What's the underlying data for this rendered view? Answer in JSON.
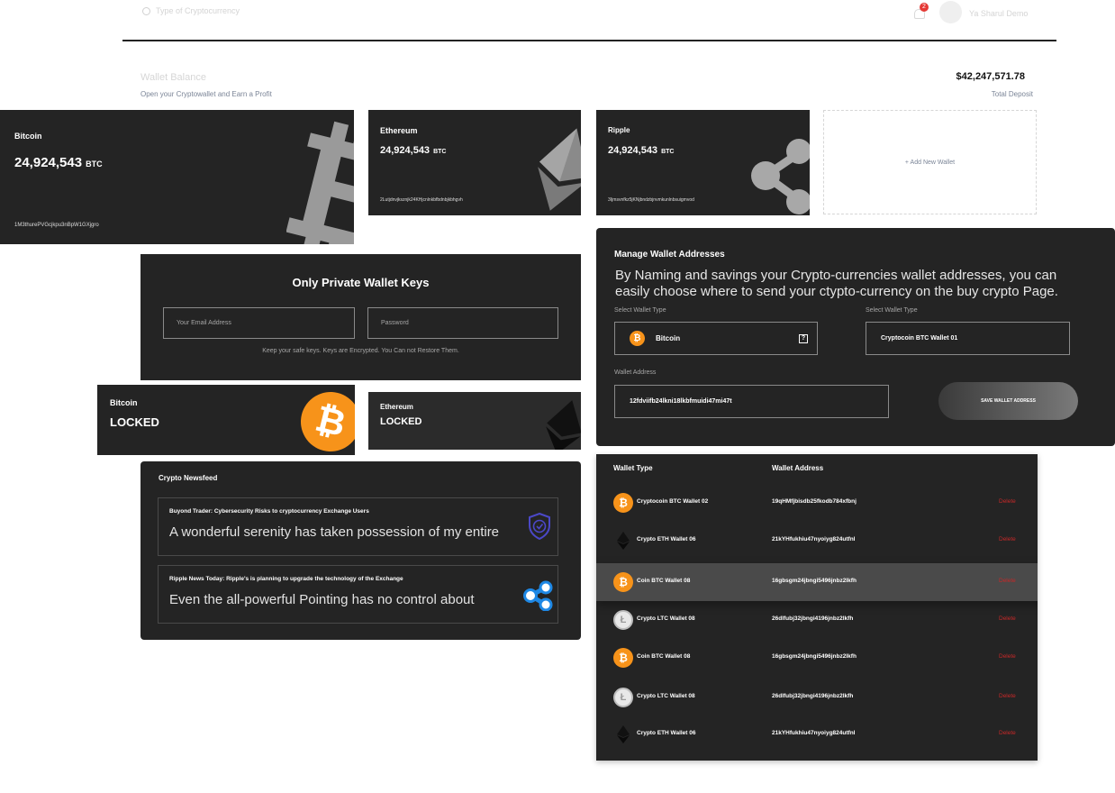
{
  "header": {
    "search_placeholder": "Type of Cryptocurrency",
    "notification_count": "2",
    "user_name": "Ya Sharul Demo"
  },
  "wallet_balance": {
    "title": "Wallet Balance",
    "subtitle": "Open your Cryptowallet and Earn a Profit",
    "total_amount": "$42,247,571.78",
    "total_label": "Total Deposit"
  },
  "wallets": [
    {
      "name": "Bitcoin",
      "amount": "24,924,543",
      "unit": "BTC",
      "address": "1M3thurePVGcjkpu3nBpW1GXjgro"
    },
    {
      "name": "Ethereum",
      "amount": "24,924,543",
      "unit": "BTC",
      "address": "2Lutjdnvjksznjk24KHjcnlnkbfbdnbjkbhgvh"
    },
    {
      "name": "Ripple",
      "amount": "24,924,543",
      "unit": "BTC",
      "address": "3Ijmsvnfkz5jKNjbndzbjnvmkunlnbsuigmvod"
    }
  ],
  "add_wallet_label": "+ Add New Wallet",
  "private_keys": {
    "title": "Only Private Wallet Keys",
    "email_placeholder": "Your Email Address",
    "password_placeholder": "Password",
    "note": "Keep your safe keys. Keys are Encrypted. You Can not Restore Them."
  },
  "locked": [
    {
      "name": "Bitcoin",
      "status": "LOCKED"
    },
    {
      "name": "Ethereum",
      "status": "LOCKED"
    }
  ],
  "newsfeed": {
    "title": "Crypto Newsfeed",
    "items": [
      {
        "headline": "Buyond Trader: Cybersecurity Risks to cryptocurrency Exchange Users",
        "body": "A wonderful serenity has taken possession of my entire"
      },
      {
        "headline": "Ripple News Today: Ripple's is planning to upgrade the technology of the Exchange",
        "body": "Even the all-powerful Pointing has no control about"
      }
    ]
  },
  "manage": {
    "title": "Manage Wallet Addresses",
    "description": "By Naming and savings your Crypto-currencies wallet addresses, you can easily choose where to send your ctypto-currency on the buy crypto Page.",
    "select_label_1": "Select Wallet Type",
    "select_value_1": "Bitcoin",
    "select_label_2": "Select Wallet Type",
    "select_value_2": "Cryptocoin BTC Wallet 01",
    "address_label": "Wallet Address",
    "address_value": "12fdviifb24lkni18lkbfmuidi47mi47t",
    "save_label": "SAVE WALLET ADDRESS"
  },
  "table": {
    "col_type": "Wallet Type",
    "col_address": "Wallet Address",
    "rows": [
      {
        "coin": "btc",
        "name": "Cryptocoin BTC Wallet 02",
        "address": "19qHMfjbisdb25fkodb784xfbnj",
        "action": "Delete"
      },
      {
        "coin": "eth",
        "name": "Crypto ETH Wallet 06",
        "address": "21kYHfukhiu47nyoiyg824utfnl",
        "action": "Delete"
      },
      {
        "coin": "btc",
        "name": "Coin BTC Wallet 08",
        "address": "16gbsgm24jbngi5496jnbz2lkfh",
        "action": "Delete"
      },
      {
        "coin": "ltc",
        "name": "Crypto LTC Wallet 08",
        "address": "26dlfubj32jbngi4196jnbz2lkfh",
        "action": "Delete"
      },
      {
        "coin": "btc",
        "name": "Coin BTC Wallet 08",
        "address": "16gbsgm24jbngi5496jnbz2lkfh",
        "action": "Delete"
      },
      {
        "coin": "ltc",
        "name": "Crypto LTC Wallet 08",
        "address": "26dlfubj32jbngi4196jnbz2lkfh",
        "action": "Delete"
      },
      {
        "coin": "eth",
        "name": "Crypto ETH Wallet 06",
        "address": "21kYHfukhiu47nyoiyg824utfnl",
        "action": "Delete"
      }
    ]
  },
  "colors": {
    "card_bg": "#242424",
    "bitcoin_orange": "#f7931a",
    "delete_red": "#c62828",
    "muted_text": "#7b8597"
  }
}
